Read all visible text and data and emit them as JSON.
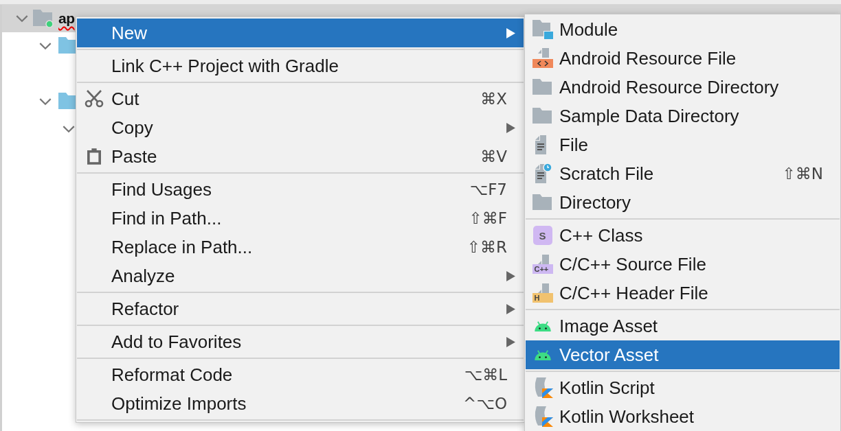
{
  "project_tree": [
    {
      "label": "ap",
      "kind": "module",
      "expanded": true,
      "selected": true,
      "children": [
        {
          "kind": "folder",
          "expanded": true
        },
        {
          "kind": "folder",
          "expanded": true,
          "children": [
            {
              "expanded": true
            }
          ]
        }
      ]
    }
  ],
  "context_menu": {
    "groups": [
      [
        {
          "label": "New",
          "submenu": true,
          "selected": true
        }
      ],
      [
        {
          "label": "Link C++ Project with Gradle",
          "submenu": false,
          "selected": false
        }
      ],
      [
        {
          "label": "Cut",
          "kind": "scissors",
          "shortcut": "⌘X",
          "submenu": false,
          "selected": false
        },
        {
          "label": "Copy",
          "submenu": true,
          "selected": false
        },
        {
          "label": "Paste",
          "kind": "clipboard",
          "shortcut": "⌘V",
          "submenu": false,
          "selected": false
        }
      ],
      [
        {
          "label": "Find Usages",
          "shortcut": "⌥F7",
          "submenu": false,
          "selected": false
        },
        {
          "label": "Find in Path...",
          "shortcut": "⇧⌘F",
          "submenu": false,
          "selected": false
        },
        {
          "label": "Replace in Path...",
          "shortcut": "⇧⌘R",
          "submenu": false,
          "selected": false
        },
        {
          "label": "Analyze",
          "submenu": true,
          "selected": false
        }
      ],
      [
        {
          "label": "Refactor",
          "submenu": true,
          "selected": false
        }
      ],
      [
        {
          "label": "Add to Favorites",
          "submenu": true,
          "selected": false
        }
      ],
      [
        {
          "label": "Reformat Code",
          "shortcut": "⌥⌘L",
          "submenu": false,
          "selected": false
        },
        {
          "label": "Optimize Imports",
          "shortcut": "^⌥O",
          "submenu": false,
          "selected": false
        }
      ]
    ]
  },
  "new_submenu": {
    "groups": [
      [
        {
          "label": "Module",
          "kind": "module",
          "selected": false
        },
        {
          "label": "Android Resource File",
          "kind": "resource",
          "selected": false
        },
        {
          "label": "Android Resource Directory",
          "kind": "folder",
          "selected": false
        },
        {
          "label": "Sample Data Directory",
          "kind": "folder",
          "selected": false
        },
        {
          "label": "File",
          "kind": "file",
          "selected": false
        },
        {
          "label": "Scratch File",
          "kind": "scratch",
          "shortcut": "⇧⌘N",
          "selected": false
        },
        {
          "label": "Directory",
          "kind": "folder",
          "selected": false
        }
      ],
      [
        {
          "label": "C++ Class",
          "kind": "class",
          "icon_text": "S",
          "selected": false
        },
        {
          "label": "C/C++ Source File",
          "kind": "source",
          "icon_text": "C++",
          "selected": false
        },
        {
          "label": "C/C++ Header File",
          "kind": "header",
          "icon_text": "H",
          "selected": false
        }
      ],
      [
        {
          "label": "Image Asset",
          "kind": "android",
          "selected": false
        },
        {
          "label": "Vector Asset",
          "kind": "android",
          "selected": true
        }
      ],
      [
        {
          "label": "Kotlin Script",
          "kind": "kotlin",
          "selected": false
        },
        {
          "label": "Kotlin Worksheet",
          "kind": "kotlin",
          "selected": false
        }
      ]
    ]
  }
}
